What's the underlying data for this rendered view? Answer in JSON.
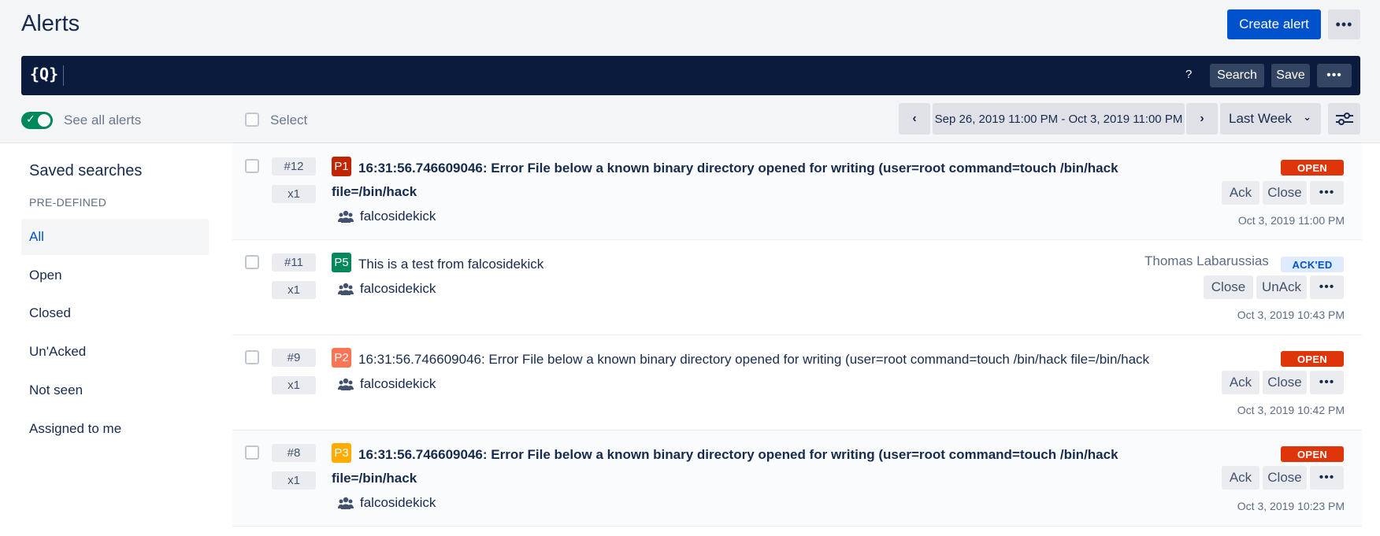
{
  "header": {
    "title": "Alerts",
    "create_label": "Create alert",
    "more_label": "•••"
  },
  "querybar": {
    "icon_text": "{Q}",
    "help_label": "?",
    "search_label": "Search",
    "save_label": "Save",
    "more_label": "•••"
  },
  "filters": {
    "see_all_label": "See all alerts",
    "see_all_on": true,
    "select_label": "Select",
    "prev_label": "‹",
    "next_label": "›",
    "date_range": "Sep 26, 2019 11:00 PM - Oct 3, 2019 11:00 PM",
    "period": "Last Week",
    "period_chevron": "⌄"
  },
  "sidebar": {
    "title": "Saved searches",
    "section": "PRE-DEFINED",
    "items": [
      {
        "label": "All",
        "active": true
      },
      {
        "label": "Open",
        "active": false
      },
      {
        "label": "Closed",
        "active": false
      },
      {
        "label": "Un'Acked",
        "active": false
      },
      {
        "label": "Not seen",
        "active": false
      },
      {
        "label": "Assigned to me",
        "active": false
      }
    ]
  },
  "alerts": [
    {
      "tiny_id": "#12",
      "count": "x1",
      "priority": "P1",
      "message": "16:31:56.746609046: Error File below a known binary directory opened for writing (user=root command=touch /bin/hack file=/bin/hack",
      "team": "falcosidekick",
      "status": "OPEN",
      "owner": "",
      "actions": [
        "Ack",
        "Close"
      ],
      "more": "•••",
      "time": "Oct 3, 2019 11:00 PM"
    },
    {
      "tiny_id": "#11",
      "count": "x1",
      "priority": "P5",
      "message": "This is a test from falcosidekick",
      "team": "falcosidekick",
      "status": "ACK'ED",
      "owner": "Thomas Labarussias",
      "actions": [
        "Close",
        "UnAck"
      ],
      "more": "•••",
      "time": "Oct 3, 2019 10:43 PM"
    },
    {
      "tiny_id": "#9",
      "count": "x1",
      "priority": "P2",
      "message": "16:31:56.746609046: Error File below a known binary directory opened for writing (user=root command=touch /bin/hack file=/bin/hack",
      "team": "falcosidekick",
      "status": "OPEN",
      "owner": "",
      "actions": [
        "Ack",
        "Close"
      ],
      "more": "•••",
      "time": "Oct 3, 2019 10:42 PM"
    },
    {
      "tiny_id": "#8",
      "count": "x1",
      "priority": "P3",
      "message": "16:31:56.746609046: Error File below a known binary directory opened for writing (user=root command=touch /bin/hack file=/bin/hack",
      "team": "falcosidekick",
      "status": "OPEN",
      "owner": "",
      "actions": [
        "Ack",
        "Close"
      ],
      "more": "•••",
      "time": "Oct 3, 2019 10:23 PM"
    }
  ],
  "colors": {
    "primary": "#0052cc",
    "navy": "#0b1b3e",
    "open_red": "#de350b",
    "p1": "#bf2600",
    "p2": "#ff7452",
    "p3": "#ffab00",
    "p5": "#00875a"
  }
}
